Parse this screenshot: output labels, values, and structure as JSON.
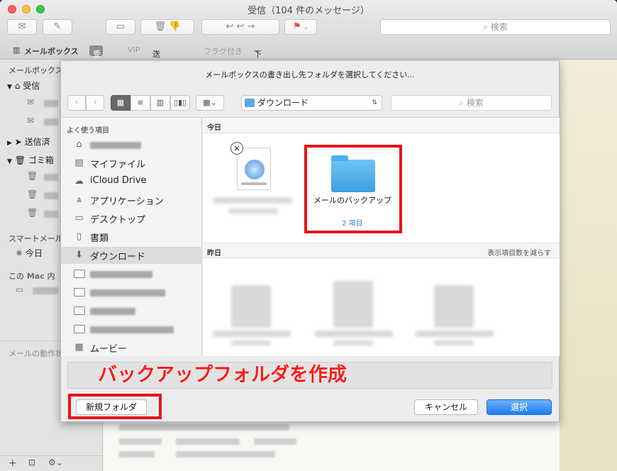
{
  "window": {
    "title": "受信（104 件のメッセージ）",
    "search_placeholder": "検索"
  },
  "favorites_bar": {
    "mailboxes": "メールボックス",
    "inbox": "受信",
    "vip": "VIP",
    "sent": "送信済み",
    "flagged": "フラグ付き",
    "drafts": "下書き"
  },
  "sidebar": {
    "section_mailboxes": "メールボックス",
    "inbox": "受信",
    "sent": "送信済",
    "trash": "ゴミ箱",
    "section_smart": "スマートメール",
    "today": "今日",
    "section_mac": "この Mac 内",
    "activity": "メールの動作状"
  },
  "sheet": {
    "title": "メールボックスの書き出し先フォルダを選択してください...",
    "path": "ダウンロード",
    "search_placeholder": "検索",
    "sidebar_header": "よく使う項目",
    "places": [
      "マイファイル",
      "iCloud Drive",
      "アプリケーション",
      "デスクトップ",
      "書類",
      "ダウンロード",
      "ムービー"
    ],
    "group_today": "今日",
    "group_yesterday": "昨日",
    "show_fewer": "表示項目数を減らす",
    "folder_name": "メールのバックアップ",
    "folder_count": "2 項目",
    "new_folder": "新規フォルダ",
    "cancel": "キャンセル",
    "choose": "選択"
  },
  "annotation": "バックアップフォルダを作成",
  "colors": {
    "highlight": "#e4141c",
    "primary_button": "#1e7cf2",
    "folder": "#4eb0ec"
  }
}
